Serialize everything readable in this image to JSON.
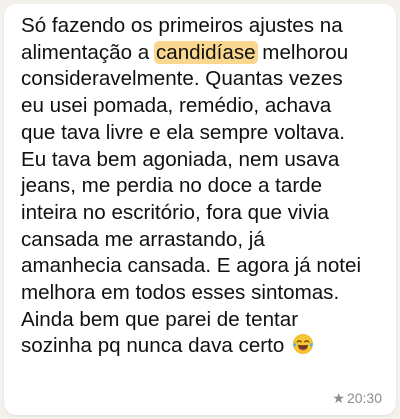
{
  "message": {
    "lines": [
      {
        "text": "Só fazendo os primeiros ajustes na"
      },
      {
        "before": "alimentação a ",
        "highlight": "candidíase",
        "after": " melhorou"
      },
      {
        "text": "consideravelmente.  Quantas vezes"
      },
      {
        "text": "eu usei pomada, remédio, achava"
      },
      {
        "text": "que tava livre e ela sempre voltava."
      },
      {
        "text": "Eu tava bem agoniada, nem usava"
      },
      {
        "text": "jeans, me perdia no doce a tarde"
      },
      {
        "text": "inteira no escritório, fora que vivia"
      },
      {
        "text": "cansada me arrastando, já"
      },
      {
        "text": "amanhecia cansada. E agora já notei"
      },
      {
        "text": "melhora em todos esses sintomas."
      },
      {
        "text": "Ainda bem que parei de tentar"
      },
      {
        "text": "sozinha pq nunca dava certo "
      }
    ],
    "highlight_color": "#f9d78e",
    "emoji": "face-with-tears-of-joy-icon"
  },
  "meta": {
    "star": "★",
    "time": "20:30"
  },
  "colors": {
    "background": "#f4f1ed",
    "bubble": "#ffffff",
    "text": "#111111",
    "meta_text": "#8c8c8c"
  }
}
